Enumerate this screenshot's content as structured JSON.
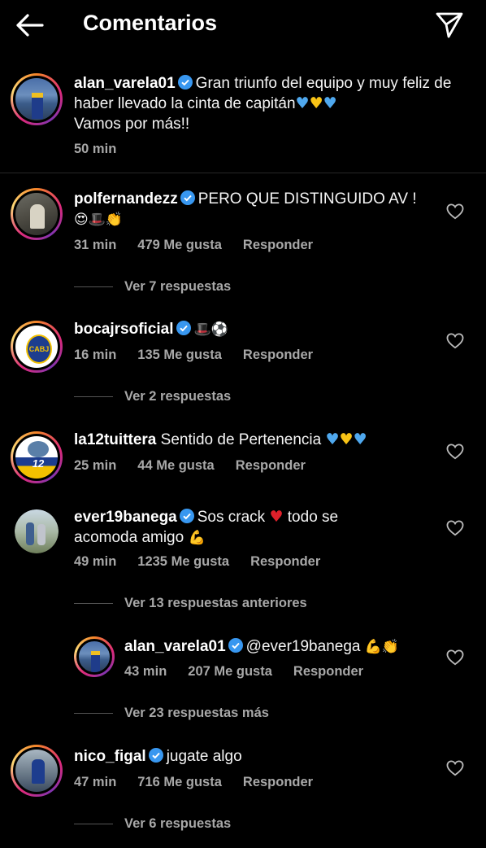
{
  "header": {
    "title": "Comentarios"
  },
  "caption": {
    "username": "alan_varela01",
    "text": "Gran triunfo del equipo y muy feliz de haber llevado la cinta de capitán",
    "line3": "Vamos por más!!",
    "time": "50 min"
  },
  "comments": [
    {
      "username": "polfernandezz",
      "text": "PERO QUE DISTINGUIDO AV !",
      "emojis": "😍🎩👏",
      "time": "31 min",
      "likes": "479 Me gusta",
      "reply": "Responder",
      "view_replies": "Ver 7 respuestas"
    },
    {
      "username": "bocajrsoficial",
      "text": "",
      "emojis": "🎩⚽",
      "time": "16 min",
      "likes": "135 Me gusta",
      "reply": "Responder",
      "view_replies": "Ver 2 respuestas",
      "avatar_text": "CABJ"
    },
    {
      "username": "la12tuittera",
      "text": "Sentido de Pertenencia",
      "time": "25 min",
      "likes": "44 Me gusta",
      "reply": "Responder",
      "avatar_text": "12"
    },
    {
      "username": "ever19banega",
      "text": "Sos crack",
      "text2": "todo se",
      "line2": "acomoda amigo",
      "emojis": "💪",
      "time": "49 min",
      "likes": "1235 Me gusta",
      "reply": "Responder",
      "view_replies": "Ver 13 respuestas anteriores"
    },
    {
      "username": "alan_varela01",
      "text": "@ever19banega",
      "emojis": "💪👏",
      "time": "43 min",
      "likes": "207 Me gusta",
      "reply": "Responder",
      "view_replies": "Ver 23 respuestas más"
    },
    {
      "username": "nico_figal",
      "text": "jugate algo",
      "time": "47 min",
      "likes": "716 Me gusta",
      "reply": "Responder",
      "view_replies": "Ver 6 respuestas"
    }
  ],
  "colors": {
    "background": "#000000",
    "verified": "#3897f0",
    "muted": "#a8a8a8"
  },
  "icons": [
    "back-arrow-icon",
    "send-icon",
    "verified-icon",
    "heart-icon"
  ]
}
